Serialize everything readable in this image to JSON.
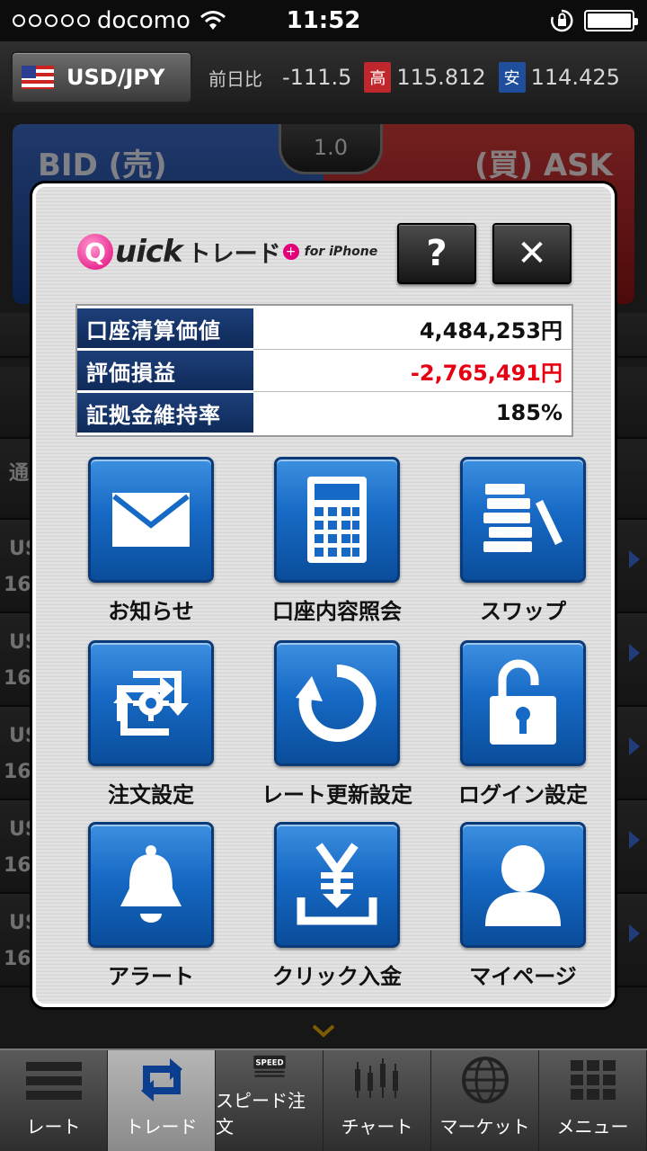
{
  "status": {
    "carrier": "docomo",
    "time": "11:52"
  },
  "header": {
    "pair": "USD/JPY",
    "day_change_label": "前日比",
    "day_change": "-111.5",
    "high_label": "高",
    "high": "115.812",
    "low_label": "安",
    "low": "114.425"
  },
  "quote": {
    "bid_label": "BID (売)",
    "ask_label": "(買) ASK",
    "spread": "1.0"
  },
  "background_rows": [
    {
      "sym": "US",
      "date": "16"
    },
    {
      "sym": "US",
      "date": "16"
    },
    {
      "sym": "US",
      "date": "16"
    },
    {
      "sym": "US",
      "date": "16"
    },
    {
      "sym": "US",
      "date": "16"
    }
  ],
  "background_side_label": "通",
  "modal": {
    "logo": {
      "q": "Q",
      "word": "uick",
      "trade": "トレード",
      "plus": "+",
      "sub": "for iPhone"
    },
    "help_label": "?",
    "close_label": "✕",
    "account": [
      {
        "label": "口座清算価値",
        "value": "4,484,253円",
        "negative": false
      },
      {
        "label": "評価損益",
        "value": "-2,765,491円",
        "negative": true
      },
      {
        "label": "証拠金維持率",
        "value": "185%",
        "negative": false
      }
    ],
    "tiles": [
      {
        "label": "お知らせ",
        "icon": "mail-icon"
      },
      {
        "label": "口座内容照会",
        "icon": "calculator-icon"
      },
      {
        "label": "スワップ",
        "icon": "swap-icon"
      },
      {
        "label": "注文設定",
        "icon": "order-settings-icon"
      },
      {
        "label": "レート更新設定",
        "icon": "refresh-icon"
      },
      {
        "label": "ログイン設定",
        "icon": "lock-icon"
      },
      {
        "label": "アラート",
        "icon": "bell-icon"
      },
      {
        "label": "クリック入金",
        "icon": "yen-deposit-icon"
      },
      {
        "label": "マイページ",
        "icon": "user-icon"
      }
    ]
  },
  "tabs": [
    {
      "label": "レート",
      "icon": "rate-icon",
      "active": false
    },
    {
      "label": "トレード",
      "icon": "trade-icon",
      "active": true
    },
    {
      "label": "スピード注文",
      "icon": "speed-icon",
      "active": false
    },
    {
      "label": "チャート",
      "icon": "chart-icon",
      "active": false
    },
    {
      "label": "マーケット",
      "icon": "globe-icon",
      "active": false
    },
    {
      "label": "メニュー",
      "icon": "grid-menu-icon",
      "active": false
    }
  ],
  "colors": {
    "tile_blue": "#1669c4",
    "account_header": "#1d3f79",
    "negative": "#e60012",
    "brand_pink": "#e2007a"
  }
}
